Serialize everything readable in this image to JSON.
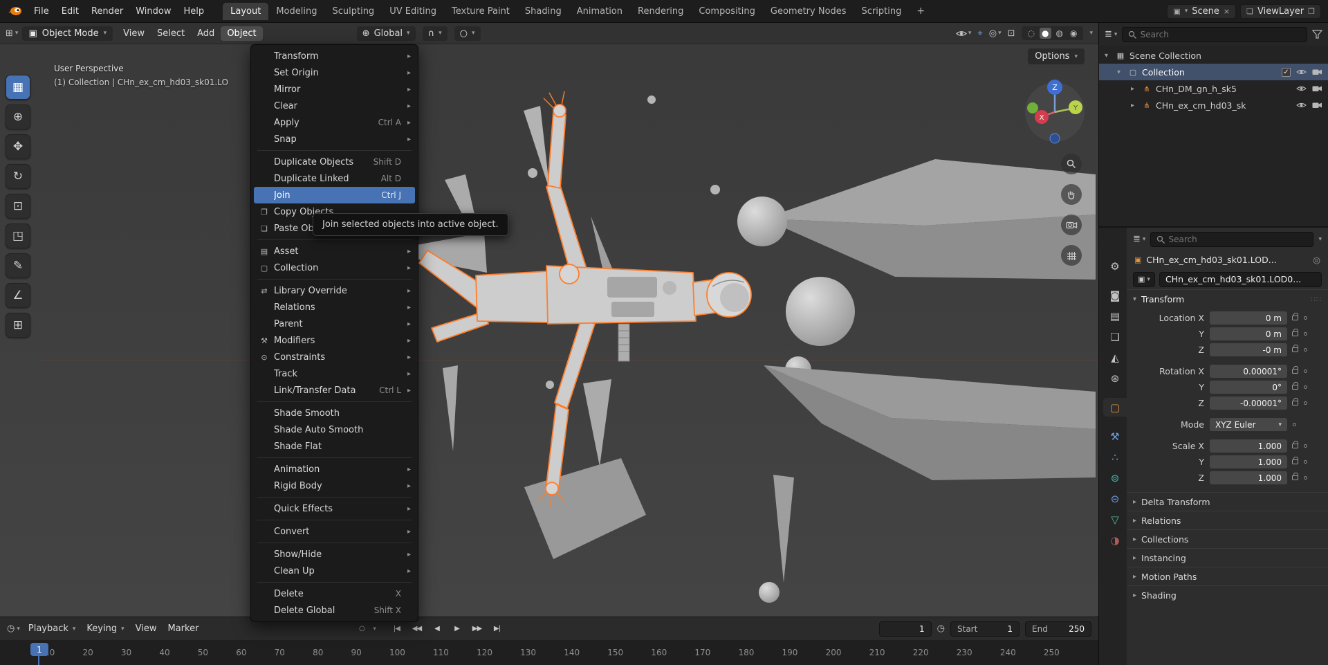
{
  "colors": {
    "accent": "#4772b3",
    "selection_outline": "#ff7d2a",
    "object_icon": "#e8923c"
  },
  "icons": {
    "caret": "▾",
    "submenu": "▸",
    "close": "×",
    "copy": "❐",
    "plus": "+",
    "autokey": "○",
    "clock": "◷",
    "globe": "⊕",
    "magnet": "∩",
    "proportional": "○",
    "gizmo_tool": "⌖",
    "overlays": "◎",
    "xray": "⊡",
    "editor_viewport": "⊞",
    "editor_timeline": "◷",
    "editor_outliner": "≣",
    "editor_props": "≣",
    "mode_cube": "▣",
    "scene": "▣",
    "viewlayer": "❏",
    "pin": "◎",
    "drag_dots": "∷∷",
    "object_data": "▣",
    "eye_caret": "▾"
  },
  "topbar": {
    "app_menus": [
      "File",
      "Edit",
      "Render",
      "Window",
      "Help"
    ],
    "workspaces": [
      {
        "label": "Layout",
        "active": true
      },
      {
        "label": "Modeling"
      },
      {
        "label": "Sculpting"
      },
      {
        "label": "UV Editing"
      },
      {
        "label": "Texture Paint"
      },
      {
        "label": "Shading"
      },
      {
        "label": "Animation"
      },
      {
        "label": "Rendering"
      },
      {
        "label": "Compositing"
      },
      {
        "label": "Geometry Nodes"
      },
      {
        "label": "Scripting"
      }
    ],
    "add_workspace": "+",
    "scene_name": "Scene",
    "viewlayer_name": "ViewLayer"
  },
  "viewport_header": {
    "mode": "Object Mode",
    "menus": [
      {
        "label": "View"
      },
      {
        "label": "Select"
      },
      {
        "label": "Add"
      },
      {
        "label": "Object",
        "active": true
      }
    ],
    "orientation": "Global",
    "shading_modes": [
      {
        "glyph": "◌"
      },
      {
        "glyph": "●",
        "active": true
      },
      {
        "glyph": "◍"
      },
      {
        "glyph": "◉"
      }
    ],
    "options_label": "Options"
  },
  "toolbar": {
    "tools": [
      {
        "name": "select-box",
        "glyph": "▦",
        "active": true
      },
      {
        "name": "cursor",
        "glyph": "⊕"
      },
      {
        "name": "move",
        "glyph": "✥"
      },
      {
        "name": "rotate",
        "glyph": "↻"
      },
      {
        "name": "scale",
        "glyph": "⊡"
      },
      {
        "name": "transform",
        "glyph": "◳"
      },
      {
        "name": "annotate",
        "glyph": "✎"
      },
      {
        "name": "measure",
        "glyph": "∠"
      },
      {
        "name": "add-cube",
        "glyph": "⊞"
      }
    ]
  },
  "viewport": {
    "perspective_label": "User Perspective",
    "collection_label": "(1) Collection | CHn_ex_cm_hd03_sk01.LO",
    "gizmo": {
      "x": "X",
      "y": "Y",
      "z": "Z"
    }
  },
  "object_menu": {
    "items": [
      {
        "label": "Transform",
        "arrow": "▸"
      },
      {
        "label": "Set Origin",
        "arrow": "▸"
      },
      {
        "label": "Mirror",
        "arrow": "▸"
      },
      {
        "label": "Clear",
        "arrow": "▸"
      },
      {
        "label": "Apply",
        "shortcut": "Ctrl A",
        "arrow": "▸"
      },
      {
        "label": "Snap",
        "arrow": "▸"
      },
      {
        "sep": true
      },
      {
        "label": "Duplicate Objects",
        "shortcut": "Shift D"
      },
      {
        "label": "Duplicate Linked",
        "shortcut": "Alt D"
      },
      {
        "label": "Join",
        "shortcut": "Ctrl J",
        "active": true
      },
      {
        "label": "Copy Objects",
        "icon": "❐"
      },
      {
        "label": "Paste Objects",
        "icon": "❏"
      },
      {
        "sep": true
      },
      {
        "label": "Asset",
        "icon": "▤",
        "arrow": "▸"
      },
      {
        "label": "Collection",
        "icon": "▢",
        "arrow": "▸"
      },
      {
        "sep": true
      },
      {
        "label": "Library Override",
        "icon": "⇄",
        "arrow": "▸"
      },
      {
        "label": "Relations",
        "arrow": "▸"
      },
      {
        "label": "Parent",
        "arrow": "▸"
      },
      {
        "label": "Modifiers",
        "icon": "⚒",
        "arrow": "▸"
      },
      {
        "label": "Constraints",
        "icon": "⊙",
        "arrow": "▸"
      },
      {
        "label": "Track",
        "arrow": "▸"
      },
      {
        "label": "Link/Transfer Data",
        "shortcut": "Ctrl L",
        "arrow": "▸"
      },
      {
        "sep": true
      },
      {
        "label": "Shade Smooth"
      },
      {
        "label": "Shade Auto Smooth"
      },
      {
        "label": "Shade Flat"
      },
      {
        "sep": true
      },
      {
        "label": "Animation",
        "arrow": "▸"
      },
      {
        "label": "Rigid Body",
        "arrow": "▸"
      },
      {
        "sep": true
      },
      {
        "label": "Quick Effects",
        "arrow": "▸"
      },
      {
        "sep": true
      },
      {
        "label": "Convert",
        "arrow": "▸"
      },
      {
        "sep": true
      },
      {
        "label": "Show/Hide",
        "arrow": "▸"
      },
      {
        "label": "Clean Up",
        "arrow": "▸"
      },
      {
        "sep": true
      },
      {
        "label": "Delete",
        "shortcut": "X"
      },
      {
        "label": "Delete Global",
        "shortcut": "Shift X"
      }
    ]
  },
  "tooltip": {
    "text": "Join selected objects into active object."
  },
  "timeline": {
    "menus": [
      {
        "label": "Playback",
        "caret": "▾"
      },
      {
        "label": "Keying",
        "caret": "▾"
      },
      {
        "label": "View"
      },
      {
        "label": "Marker"
      }
    ],
    "transport": [
      {
        "name": "jump-to-start",
        "glyph": "|◀"
      },
      {
        "name": "prev-keyframe",
        "glyph": "◀◀"
      },
      {
        "name": "play-reverse",
        "glyph": "◀"
      },
      {
        "name": "play",
        "glyph": "▶"
      },
      {
        "name": "next-keyframe",
        "glyph": "▶▶"
      },
      {
        "name": "jump-to-end",
        "glyph": "▶|"
      }
    ],
    "current_frame": "1",
    "start_label": "Start",
    "start_value": "1",
    "end_label": "End",
    "end_value": "250",
    "marker_frame": "1",
    "ruler": [
      "10",
      "20",
      "30",
      "40",
      "50",
      "60",
      "70",
      "80",
      "90",
      "100",
      "110",
      "120",
      "130",
      "140",
      "150",
      "160",
      "170",
      "180",
      "190",
      "200",
      "210",
      "220",
      "230",
      "240",
      "250"
    ]
  },
  "outliner": {
    "search_placeholder": "Search",
    "rows": [
      {
        "label": "Scene Collection",
        "caret": "▾",
        "glyph": "▦"
      },
      {
        "label": "Collection",
        "caret": "▾",
        "glyph": "▢",
        "d1": true,
        "selected": true,
        "checkbox": "✓",
        "eye": true,
        "camera": true
      },
      {
        "label": "CHn_DM_gn_h_sk5",
        "caret": "▸",
        "glyph": "⋔",
        "orange": true,
        "d2": true,
        "eye": true,
        "camera": true
      },
      {
        "label": "CHn_ex_cm_hd03_sk",
        "caret": "▸",
        "glyph": "⋔",
        "orange": true,
        "d2": true,
        "eye": true,
        "camera": true
      }
    ]
  },
  "properties": {
    "search_placeholder": "Search",
    "breadcrumb": "CHn_ex_cm_hd03_sk01.LOD...",
    "object_name": "CHn_ex_cm_hd03_sk01.LOD0...",
    "tabs": [
      {
        "name": "tool",
        "glyph": "⚙"
      },
      {
        "name": "render",
        "glyph": "◙",
        "group": true
      },
      {
        "name": "output",
        "glyph": "▤"
      },
      {
        "name": "view-layer",
        "glyph": "❏"
      },
      {
        "name": "scene",
        "glyph": "◭"
      },
      {
        "name": "world",
        "glyph": "⊛"
      },
      {
        "name": "object",
        "glyph": "▢",
        "active": true,
        "orange": true,
        "group": true
      },
      {
        "name": "modifiers",
        "glyph": "⚒",
        "blue": true,
        "group": true
      },
      {
        "name": "particles",
        "glyph": "∴",
        "blue": true
      },
      {
        "name": "physics",
        "glyph": "⊚",
        "teal": true
      },
      {
        "name": "constraints",
        "glyph": "⊝",
        "blue": true
      },
      {
        "name": "data",
        "glyph": "▽",
        "green": true
      },
      {
        "name": "material",
        "glyph": "◑",
        "red": true
      }
    ],
    "transform": {
      "title": "Transform",
      "rows": [
        {
          "label": "Location X",
          "value": "0 m",
          "lock": true
        },
        {
          "label": "Y",
          "value": "0 m",
          "lock": true
        },
        {
          "label": "Z",
          "value": "-0 m",
          "lock": true
        },
        {
          "label": "Rotation X",
          "value": "0.00001°",
          "lock": true,
          "gap": true
        },
        {
          "label": "Y",
          "value": "0°",
          "lock": true
        },
        {
          "label": "Z",
          "value": "-0.00001°",
          "lock": true
        },
        {
          "label": "Mode",
          "value": "XYZ Euler",
          "dropdown": true,
          "gap": true
        },
        {
          "label": "Scale X",
          "value": "1.000",
          "lock": true,
          "gap": true
        },
        {
          "label": "Y",
          "value": "1.000",
          "lock": true
        },
        {
          "label": "Z",
          "value": "1.000",
          "lock": true
        }
      ]
    },
    "sections": [
      {
        "label": "Delta Transform"
      },
      {
        "label": "Relations"
      },
      {
        "label": "Collections"
      },
      {
        "label": "Instancing"
      },
      {
        "label": "Motion Paths"
      },
      {
        "label": "Shading"
      }
    ]
  }
}
